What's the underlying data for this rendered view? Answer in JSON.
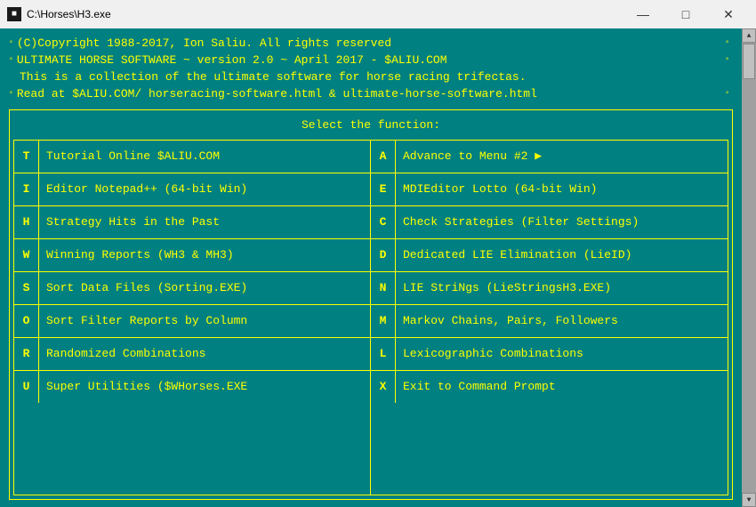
{
  "titleBar": {
    "icon": "■",
    "title": "C:\\Horses\\H3.exe",
    "minimizeLabel": "—",
    "maximizeLabel": "□",
    "closeLabel": "✕"
  },
  "header": {
    "line1": "(C)Copyright 1988-2017, Ion Saliu. All rights reserved",
    "line2": "ULTIMATE HORSE SOFTWARE ~ version 2.0 ~ April 2017 - $ALIU.COM",
    "line3": "This is a collection of the ultimate software for horse racing trifectas.",
    "line4": "Read at $ALIU.COM/ horseracing-software.html & ultimate-horse-software.html"
  },
  "menu": {
    "title": "Select the function:",
    "leftItems": [
      {
        "key": "T",
        "label": "Tutorial Online $ALIU.COM"
      },
      {
        "key": "I",
        "label": "Editor Notepad++ (64-bit Win)"
      },
      {
        "key": "H",
        "label": "Strategy Hits in the Past"
      },
      {
        "key": "W",
        "label": "Winning Reports (WH3 & MH3)"
      },
      {
        "key": "S",
        "label": "Sort Data Files (Sorting.EXE)"
      },
      {
        "key": "O",
        "label": "Sort Filter Reports by Column"
      },
      {
        "key": "R",
        "label": "Randomized Combinations"
      },
      {
        "key": "U",
        "label": "Super Utilities ($WHorses.EXE"
      }
    ],
    "rightItems": [
      {
        "key": "A",
        "label": "Advance to Menu #2 ▶"
      },
      {
        "key": "E",
        "label": "MDIEditor Lotto (64-bit Win)"
      },
      {
        "key": "C",
        "label": "Check Strategies (Filter Settings)"
      },
      {
        "key": "D",
        "label": "Dedicated LIE Elimination (LieID)"
      },
      {
        "key": "N",
        "label": "LIE StriNgs (LieStringsH3.EXE)"
      },
      {
        "key": "M",
        "label": "Markov Chains, Pairs, Followers"
      },
      {
        "key": "L",
        "label": "Lexicographic Combinations"
      },
      {
        "key": "X",
        "label": "Exit to Command Prompt"
      }
    ]
  }
}
